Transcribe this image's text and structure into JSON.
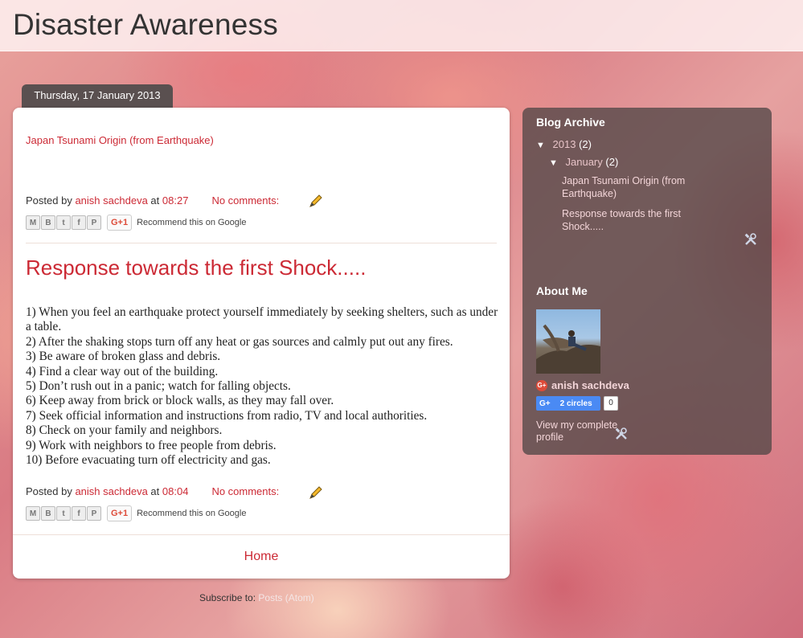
{
  "header": {
    "title": "Disaster Awareness"
  },
  "date_header": "Thursday, 17 January 2013",
  "posts": [
    {
      "title": "Japan Tsunami Origin (from Earthquake)",
      "posted_by_label": "Posted by",
      "author": "anish sachdeva",
      "at_label": "at",
      "time": "08:27",
      "comments": "No comments:"
    },
    {
      "title": "Response towards the first Shock.....",
      "body": [
        "1) When you feel an earthquake protect yourself immediately by seeking shelters, such as under a table.",
        "2) After the shaking stops turn off any heat or gas sources and calmly put out any fires.",
        "3) Be aware of broken glass and debris.",
        "4) Find a clear way out of the building.",
        "5) Don’t rush out in a panic; watch for falling objects.",
        "6) Keep away from brick or block walls, as they may fall over.",
        "7) Seek official information and instructions from radio, TV and local authorities.",
        "8) Check on your family and neighbors.",
        "9) Work with neighbors to free people from debris.",
        "10) Before evacuating turn off electricity and gas."
      ],
      "posted_by_label": "Posted by",
      "author": "anish sachdeva",
      "at_label": "at",
      "time": "08:04",
      "comments": "No comments:"
    }
  ],
  "share": {
    "icons": [
      "email-icon",
      "blogger-icon",
      "twitter-icon",
      "facebook-icon",
      "pinterest-icon"
    ],
    "gplus_label": "G+1",
    "recommend_label": "Recommend this on Google"
  },
  "home_label": "Home",
  "subscribe": {
    "label": "Subscribe to:",
    "feed": "Posts (Atom)"
  },
  "sidebar": {
    "archive": {
      "heading": "Blog Archive",
      "year": "2013",
      "year_count": "(2)",
      "month": "January",
      "month_count": "(2)",
      "posts": [
        "Japan Tsunami Origin (from Earthquake)",
        "Response towards the first Shock....."
      ]
    },
    "about": {
      "heading": "About Me",
      "name": "anish sachdeva",
      "circles_label": "2 circles",
      "circles_count": "0",
      "view_profile": "View my complete profile"
    }
  },
  "colors": {
    "link": "#cc2a35",
    "sidebar_bg": "#554848",
    "date_tab": "#5a5050"
  }
}
